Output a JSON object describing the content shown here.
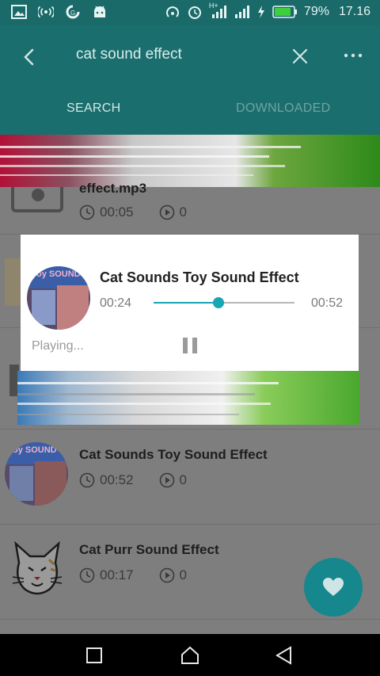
{
  "status_bar": {
    "battery": "79%",
    "time": "17.16",
    "network_label": "H+",
    "icons": [
      "gallery-icon",
      "broadcast-icon",
      "data-saver-icon",
      "android-icon",
      "hotspot-icon",
      "alarm-icon",
      "signal-icon",
      "charging-icon",
      "battery-icon"
    ]
  },
  "app_bar": {
    "search_query": "cat sound effect",
    "tabs": [
      {
        "label": "SEARCH",
        "active": true
      },
      {
        "label": "DOWNLOADED",
        "active": false
      }
    ]
  },
  "list": [
    {
      "title": "effect.mp3",
      "duration": "00:05",
      "plays": "0"
    },
    {
      "title": "Cat Sounds Toy  Sound Effect",
      "duration": "00:52",
      "plays": "0",
      "thumb_text": "oy  SOUND"
    },
    {
      "title": "Cat Purr Sound Effect",
      "duration": "00:17",
      "plays": "0"
    }
  ],
  "player": {
    "title": "Cat Sounds Toy  Sound Effect",
    "current_time": "00:24",
    "total_time": "00:52",
    "progress": 0.46,
    "status": "Playing...",
    "thumb_text": "oy  SOUND"
  },
  "colors": {
    "primary": "#1b6e6e",
    "accent": "#17a6b2",
    "fab": "#16878c"
  }
}
